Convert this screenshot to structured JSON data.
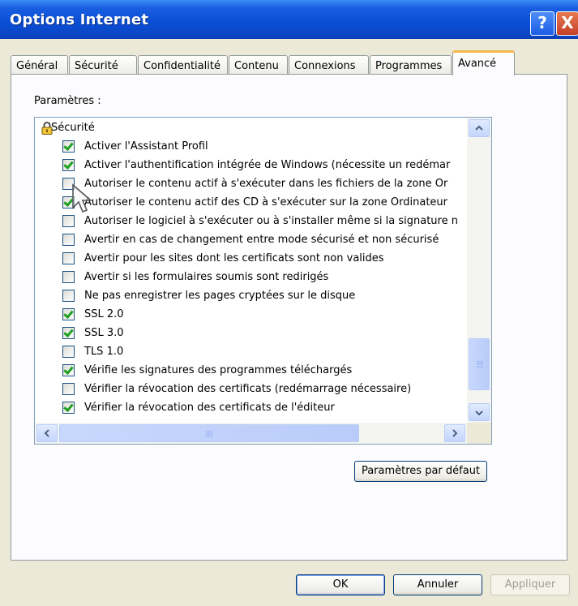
{
  "window": {
    "title": "Options Internet",
    "help_label": "?",
    "close_label": "X"
  },
  "tabs": [
    {
      "label": "Général"
    },
    {
      "label": "Sécurité"
    },
    {
      "label": "Confidentialité"
    },
    {
      "label": "Contenu"
    },
    {
      "label": "Connexions"
    },
    {
      "label": "Programmes"
    },
    {
      "label": "Avancé",
      "active": true
    }
  ],
  "settings": {
    "label": "Paramètres :",
    "category": "Sécurité",
    "items": [
      {
        "label": "Activer l'Assistant Profil",
        "checked": true
      },
      {
        "label": "Activer l'authentification intégrée de Windows (nécessite un redémar",
        "checked": true
      },
      {
        "label": "Autoriser le contenu actif à s'exécuter dans les fichiers de la zone Or",
        "checked": false
      },
      {
        "label": "Autoriser le contenu actif des CD à s'exécuter sur la zone Ordinateur",
        "checked": true
      },
      {
        "label": "Autoriser le logiciel à s'exécuter ou à s'installer même si la signature n",
        "checked": false
      },
      {
        "label": "Avertir en cas de changement entre mode sécurisé et non sécurisé",
        "checked": false
      },
      {
        "label": "Avertir pour les sites dont les certificats sont non valides",
        "checked": false
      },
      {
        "label": "Avertir si les formulaires soumis sont redirigés",
        "checked": false
      },
      {
        "label": "Ne pas enregistrer les pages cryptées sur le disque",
        "checked": false
      },
      {
        "label": "SSL 2.0",
        "checked": true
      },
      {
        "label": "SSL 3.0",
        "checked": true
      },
      {
        "label": "TLS 1.0",
        "checked": false
      },
      {
        "label": "Vérifie les signatures des programmes téléchargés",
        "checked": true
      },
      {
        "label": "Vérifier la révocation des certificats (redémarrage nécessaire)",
        "checked": false
      },
      {
        "label": "Vérifier la révocation des certificats de l'éditeur",
        "checked": true
      }
    ]
  },
  "buttons": {
    "restore_defaults": "Paramètres par défaut",
    "ok": "OK",
    "cancel": "Annuler",
    "apply": "Appliquer"
  },
  "colors": {
    "titlebar": "#0a4fd6",
    "check": "#21a121",
    "active_tab_accent": "#f7b64b"
  }
}
